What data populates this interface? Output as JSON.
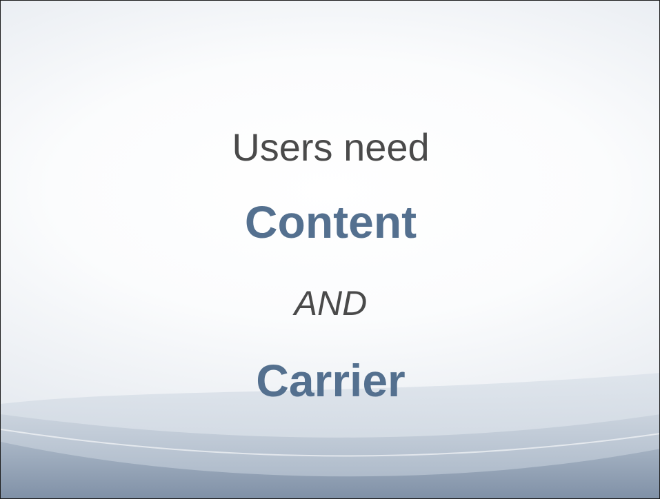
{
  "slide": {
    "lines": [
      "Users need",
      "Content",
      "AND",
      "Carrier"
    ]
  },
  "colors": {
    "body_text": "#4a4a4a",
    "accent_text": "#54708f",
    "wave_dark": "#8c9cb0",
    "wave_light": "#c9d3de"
  }
}
